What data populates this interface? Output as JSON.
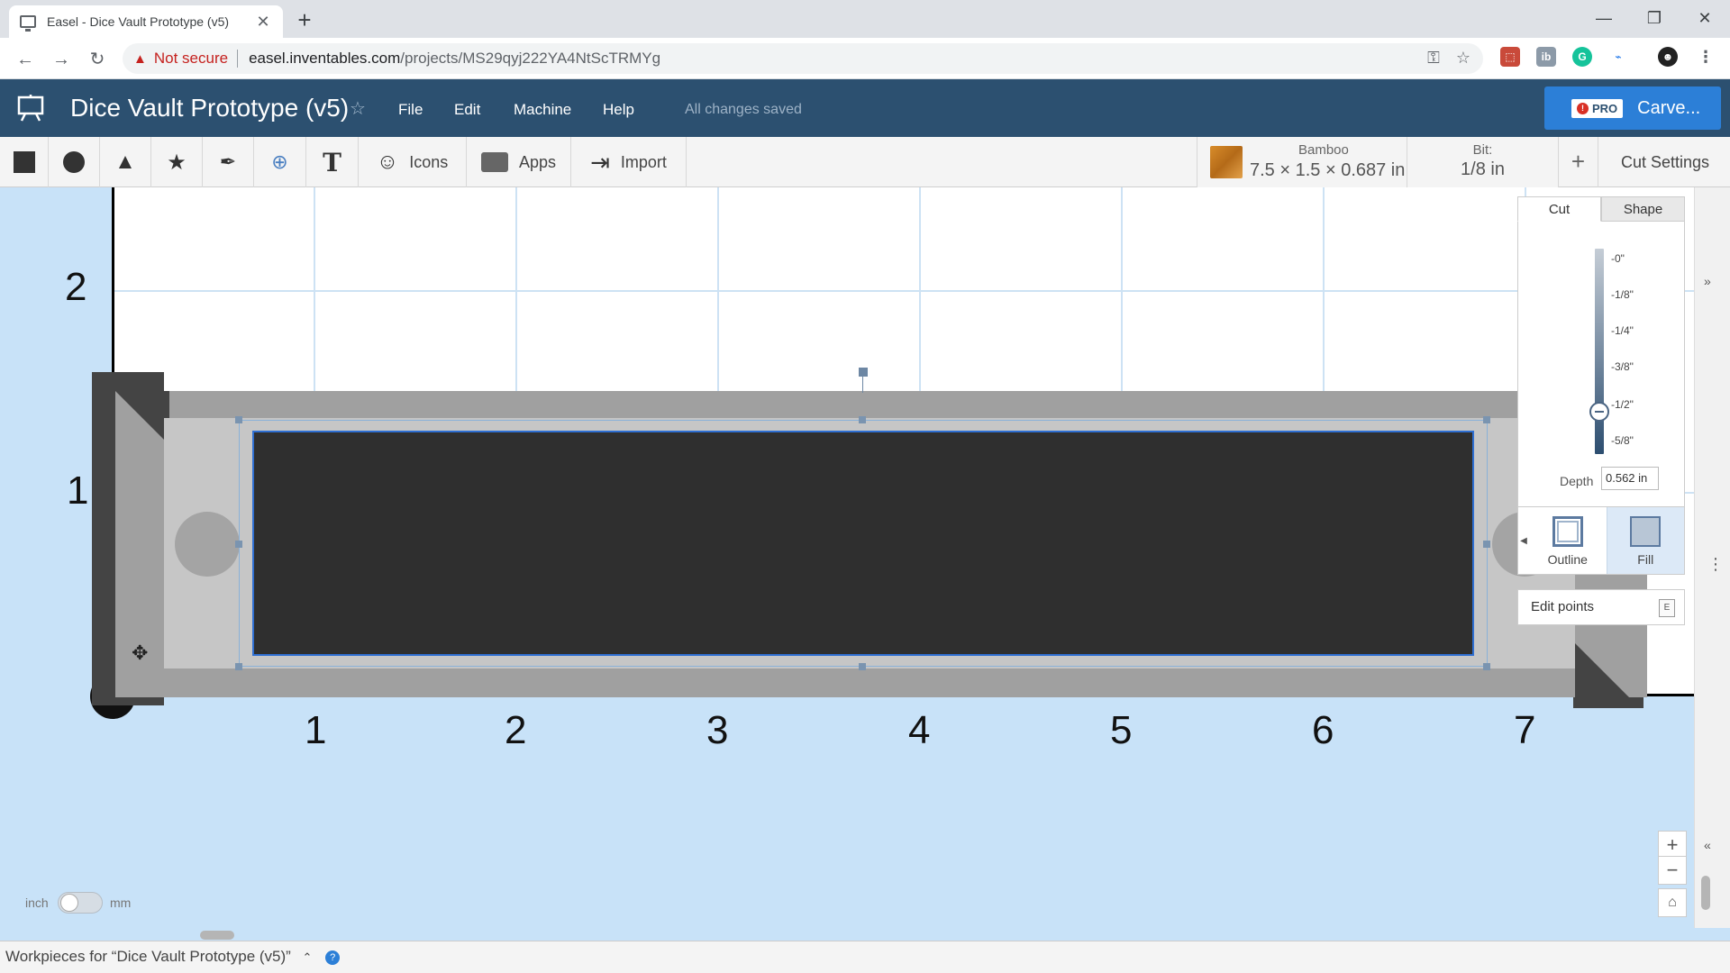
{
  "browser": {
    "tab_title": "Easel - Dice Vault Prototype (v5)",
    "not_secure": "Not secure",
    "url_host": "easel.inventables.com",
    "url_path": "/projects/MS29qyj222YA4NtScTRMYg"
  },
  "header": {
    "project_title": "Dice Vault Prototype (v5)",
    "menu": [
      "File",
      "Edit",
      "Machine",
      "Help"
    ],
    "save_status": "All changes saved",
    "pro_label": "PRO",
    "carve_label": "Carve..."
  },
  "toolbar": {
    "icons_label": "Icons",
    "apps_label": "Apps",
    "import_label": "Import",
    "material_name": "Bamboo",
    "material_dims": "7.5 × 1.5 × 0.687 in",
    "bit_label": "Bit:",
    "bit_value": "1/8 in",
    "cut_settings": "Cut Settings"
  },
  "canvas": {
    "x_ticks": [
      "1",
      "2",
      "3",
      "4",
      "5",
      "6",
      "7"
    ],
    "y_ticks": [
      "2",
      "1"
    ]
  },
  "panel": {
    "tab_cut": "Cut",
    "tab_shape": "Shape",
    "depth_marks": [
      "-0\"",
      "-1/8\"",
      "-1/4\"",
      "-3/8\"",
      "-1/2\"",
      "-5/8\""
    ],
    "depth_label": "Depth",
    "depth_value": "0.562 in",
    "mode_outline": "Outline",
    "mode_fill": "Fill",
    "edit_points": "Edit points",
    "edit_points_key": "E"
  },
  "units": {
    "left": "inch",
    "right": "mm"
  },
  "footer": {
    "workpieces": "Workpieces for “Dice Vault Prototype (v5)”"
  },
  "colors": {
    "header_bg": "#2c5070",
    "carve_btn": "#2c7fd7",
    "canvas_bg": "#c8e2f8",
    "pocket": "#2f2f2f"
  }
}
